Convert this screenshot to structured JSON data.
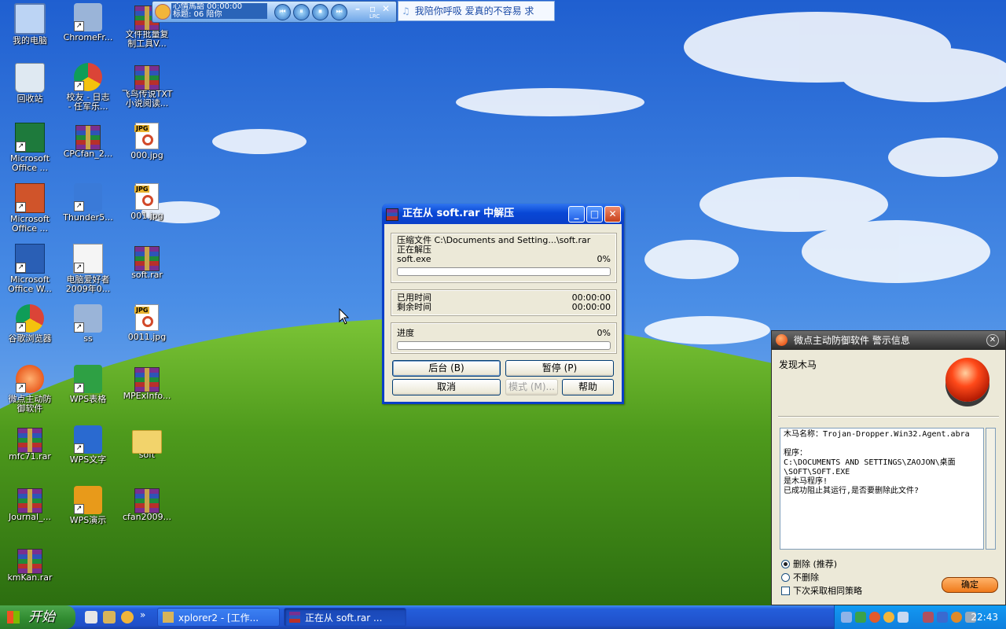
{
  "desktop": {
    "icons": [
      {
        "label": "我的电脑",
        "type": "computer"
      },
      {
        "label": "ChromeFr...",
        "type": "app"
      },
      {
        "label": "文件批量复\n制工具V...",
        "type": "rar"
      },
      {
        "label": "回收站",
        "type": "recycle"
      },
      {
        "label": "校友 - 日志\n- 任军乐...",
        "type": "chrome"
      },
      {
        "label": "飞鸟传说TXT\n小说阅读...",
        "type": "rar"
      },
      {
        "label": "Microsoft\nOffice ...",
        "type": "excel"
      },
      {
        "label": "CPCfan_2...",
        "type": "rar"
      },
      {
        "label": "000.jpg",
        "type": "jpg"
      },
      {
        "label": "Microsoft\nOffice ...",
        "type": "ppt"
      },
      {
        "label": "Thunder5...",
        "type": "thunder"
      },
      {
        "label": "001.jpg",
        "type": "jpg"
      },
      {
        "label": "Microsoft\nOffice W...",
        "type": "word"
      },
      {
        "label": "电脑爱好者\n2009年0...",
        "type": "pdf"
      },
      {
        "label": "soft.rar",
        "type": "rar"
      },
      {
        "label": "谷歌浏览器",
        "type": "chrome"
      },
      {
        "label": "ss",
        "type": "app"
      },
      {
        "label": "0011.jpg",
        "type": "jpg"
      },
      {
        "label": "微点主动防\n御软件",
        "type": "av"
      },
      {
        "label": "WPS表格",
        "type": "wps-s"
      },
      {
        "label": "MPExInfo...",
        "type": "rar"
      },
      {
        "label": "mfc71.rar",
        "type": "rar"
      },
      {
        "label": "WPS文字",
        "type": "wps-w"
      },
      {
        "label": "soft",
        "type": "folder"
      },
      {
        "label": "Journal_...",
        "type": "rar"
      },
      {
        "label": "WPS演示",
        "type": "wps-p"
      },
      {
        "label": "cfan2009...",
        "type": "rar"
      },
      {
        "label": "kmKan.rar",
        "type": "rar"
      }
    ]
  },
  "player": {
    "info_line1": "心情馬語  00:00:00",
    "info_line2": "标题: 06 陪你",
    "controls": [
      "⏮",
      "⏸",
      "⏹",
      "⏭"
    ],
    "lyric_text": "我陪你呼吸   爱真的不容易   求",
    "lrc_label": "LRC"
  },
  "rar_window": {
    "title": "正在从 soft.rar 中解压",
    "archive_label": "压缩文件 C:\\Documents and Setting...\\soft.rar",
    "status": "正在解压",
    "file_name": "soft.exe",
    "file_percent": "0%",
    "file_progress": 0,
    "elapsed_label": "已用时间",
    "elapsed_value": "00:00:00",
    "remaining_label": "剩余时间",
    "remaining_value": "00:00:00",
    "progress_label": "进度",
    "progress_percent": "0%",
    "total_progress": 0,
    "buttons": {
      "background": "后台 (B)",
      "pause": "暂停 (P)",
      "cancel": "取消",
      "mode": "模式 (M)...",
      "help": "帮助"
    }
  },
  "antivirus": {
    "title": "微点主动防御软件   警示信息",
    "heading": "发现木马",
    "message": "木马名称：Trojan-Dropper.Win32.Agent.abra\n\n程序：\nC:\\DOCUMENTS AND SETTINGS\\ZAOJON\\桌面\n\\SOFT\\SOFT.EXE\n是木马程序!\n已成功阻止其运行,是否要删除此文件?",
    "option_delete": "删除 (推荐)",
    "option_keep": "不删除",
    "option_policy": "下次采取相同策略",
    "ok": "确定"
  },
  "taskbar": {
    "start": "开始",
    "tasks": [
      {
        "label": "xplorer2 - [工作...",
        "active": false
      },
      {
        "label": "正在从 soft.rar ...",
        "active": true
      }
    ],
    "clock": "22:43"
  },
  "colors": {
    "xp_blue": "#0a3fc8",
    "start_green": "#2f8a2f",
    "tray_blue": "#0f7fdd",
    "alarm_red": "#ff4a1a"
  }
}
